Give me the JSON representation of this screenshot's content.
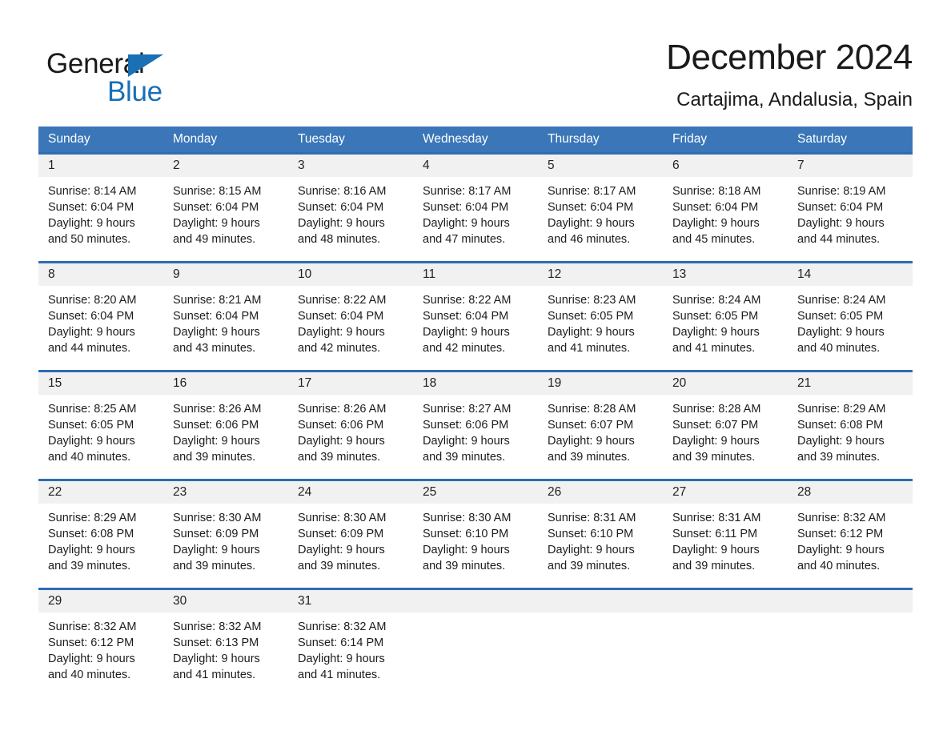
{
  "brand": {
    "name_part1": "General",
    "name_part2": "Blue",
    "triangle_color": "#1a6fb5",
    "accent_color": "#3a76b8"
  },
  "header": {
    "title": "December 2024",
    "subtitle": "Cartajima, Andalusia, Spain"
  },
  "weekdays": [
    "Sunday",
    "Monday",
    "Tuesday",
    "Wednesday",
    "Thursday",
    "Friday",
    "Saturday"
  ],
  "weeks": [
    {
      "days": [
        {
          "num": "1",
          "l1": "Sunrise: 8:14 AM",
          "l2": "Sunset: 6:04 PM",
          "l3": "Daylight: 9 hours",
          "l4": "and 50 minutes."
        },
        {
          "num": "2",
          "l1": "Sunrise: 8:15 AM",
          "l2": "Sunset: 6:04 PM",
          "l3": "Daylight: 9 hours",
          "l4": "and 49 minutes."
        },
        {
          "num": "3",
          "l1": "Sunrise: 8:16 AM",
          "l2": "Sunset: 6:04 PM",
          "l3": "Daylight: 9 hours",
          "l4": "and 48 minutes."
        },
        {
          "num": "4",
          "l1": "Sunrise: 8:17 AM",
          "l2": "Sunset: 6:04 PM",
          "l3": "Daylight: 9 hours",
          "l4": "and 47 minutes."
        },
        {
          "num": "5",
          "l1": "Sunrise: 8:17 AM",
          "l2": "Sunset: 6:04 PM",
          "l3": "Daylight: 9 hours",
          "l4": "and 46 minutes."
        },
        {
          "num": "6",
          "l1": "Sunrise: 8:18 AM",
          "l2": "Sunset: 6:04 PM",
          "l3": "Daylight: 9 hours",
          "l4": "and 45 minutes."
        },
        {
          "num": "7",
          "l1": "Sunrise: 8:19 AM",
          "l2": "Sunset: 6:04 PM",
          "l3": "Daylight: 9 hours",
          "l4": "and 44 minutes."
        }
      ]
    },
    {
      "days": [
        {
          "num": "8",
          "l1": "Sunrise: 8:20 AM",
          "l2": "Sunset: 6:04 PM",
          "l3": "Daylight: 9 hours",
          "l4": "and 44 minutes."
        },
        {
          "num": "9",
          "l1": "Sunrise: 8:21 AM",
          "l2": "Sunset: 6:04 PM",
          "l3": "Daylight: 9 hours",
          "l4": "and 43 minutes."
        },
        {
          "num": "10",
          "l1": "Sunrise: 8:22 AM",
          "l2": "Sunset: 6:04 PM",
          "l3": "Daylight: 9 hours",
          "l4": "and 42 minutes."
        },
        {
          "num": "11",
          "l1": "Sunrise: 8:22 AM",
          "l2": "Sunset: 6:04 PM",
          "l3": "Daylight: 9 hours",
          "l4": "and 42 minutes."
        },
        {
          "num": "12",
          "l1": "Sunrise: 8:23 AM",
          "l2": "Sunset: 6:05 PM",
          "l3": "Daylight: 9 hours",
          "l4": "and 41 minutes."
        },
        {
          "num": "13",
          "l1": "Sunrise: 8:24 AM",
          "l2": "Sunset: 6:05 PM",
          "l3": "Daylight: 9 hours",
          "l4": "and 41 minutes."
        },
        {
          "num": "14",
          "l1": "Sunrise: 8:24 AM",
          "l2": "Sunset: 6:05 PM",
          "l3": "Daylight: 9 hours",
          "l4": "and 40 minutes."
        }
      ]
    },
    {
      "days": [
        {
          "num": "15",
          "l1": "Sunrise: 8:25 AM",
          "l2": "Sunset: 6:05 PM",
          "l3": "Daylight: 9 hours",
          "l4": "and 40 minutes."
        },
        {
          "num": "16",
          "l1": "Sunrise: 8:26 AM",
          "l2": "Sunset: 6:06 PM",
          "l3": "Daylight: 9 hours",
          "l4": "and 39 minutes."
        },
        {
          "num": "17",
          "l1": "Sunrise: 8:26 AM",
          "l2": "Sunset: 6:06 PM",
          "l3": "Daylight: 9 hours",
          "l4": "and 39 minutes."
        },
        {
          "num": "18",
          "l1": "Sunrise: 8:27 AM",
          "l2": "Sunset: 6:06 PM",
          "l3": "Daylight: 9 hours",
          "l4": "and 39 minutes."
        },
        {
          "num": "19",
          "l1": "Sunrise: 8:28 AM",
          "l2": "Sunset: 6:07 PM",
          "l3": "Daylight: 9 hours",
          "l4": "and 39 minutes."
        },
        {
          "num": "20",
          "l1": "Sunrise: 8:28 AM",
          "l2": "Sunset: 6:07 PM",
          "l3": "Daylight: 9 hours",
          "l4": "and 39 minutes."
        },
        {
          "num": "21",
          "l1": "Sunrise: 8:29 AM",
          "l2": "Sunset: 6:08 PM",
          "l3": "Daylight: 9 hours",
          "l4": "and 39 minutes."
        }
      ]
    },
    {
      "days": [
        {
          "num": "22",
          "l1": "Sunrise: 8:29 AM",
          "l2": "Sunset: 6:08 PM",
          "l3": "Daylight: 9 hours",
          "l4": "and 39 minutes."
        },
        {
          "num": "23",
          "l1": "Sunrise: 8:30 AM",
          "l2": "Sunset: 6:09 PM",
          "l3": "Daylight: 9 hours",
          "l4": "and 39 minutes."
        },
        {
          "num": "24",
          "l1": "Sunrise: 8:30 AM",
          "l2": "Sunset: 6:09 PM",
          "l3": "Daylight: 9 hours",
          "l4": "and 39 minutes."
        },
        {
          "num": "25",
          "l1": "Sunrise: 8:30 AM",
          "l2": "Sunset: 6:10 PM",
          "l3": "Daylight: 9 hours",
          "l4": "and 39 minutes."
        },
        {
          "num": "26",
          "l1": "Sunrise: 8:31 AM",
          "l2": "Sunset: 6:10 PM",
          "l3": "Daylight: 9 hours",
          "l4": "and 39 minutes."
        },
        {
          "num": "27",
          "l1": "Sunrise: 8:31 AM",
          "l2": "Sunset: 6:11 PM",
          "l3": "Daylight: 9 hours",
          "l4": "and 39 minutes."
        },
        {
          "num": "28",
          "l1": "Sunrise: 8:32 AM",
          "l2": "Sunset: 6:12 PM",
          "l3": "Daylight: 9 hours",
          "l4": "and 40 minutes."
        }
      ]
    },
    {
      "days": [
        {
          "num": "29",
          "l1": "Sunrise: 8:32 AM",
          "l2": "Sunset: 6:12 PM",
          "l3": "Daylight: 9 hours",
          "l4": "and 40 minutes."
        },
        {
          "num": "30",
          "l1": "Sunrise: 8:32 AM",
          "l2": "Sunset: 6:13 PM",
          "l3": "Daylight: 9 hours",
          "l4": "and 41 minutes."
        },
        {
          "num": "31",
          "l1": "Sunrise: 8:32 AM",
          "l2": "Sunset: 6:14 PM",
          "l3": "Daylight: 9 hours",
          "l4": "and 41 minutes."
        },
        {
          "num": "",
          "l1": "",
          "l2": "",
          "l3": "",
          "l4": ""
        },
        {
          "num": "",
          "l1": "",
          "l2": "",
          "l3": "",
          "l4": ""
        },
        {
          "num": "",
          "l1": "",
          "l2": "",
          "l3": "",
          "l4": ""
        },
        {
          "num": "",
          "l1": "",
          "l2": "",
          "l3": "",
          "l4": ""
        }
      ]
    }
  ]
}
